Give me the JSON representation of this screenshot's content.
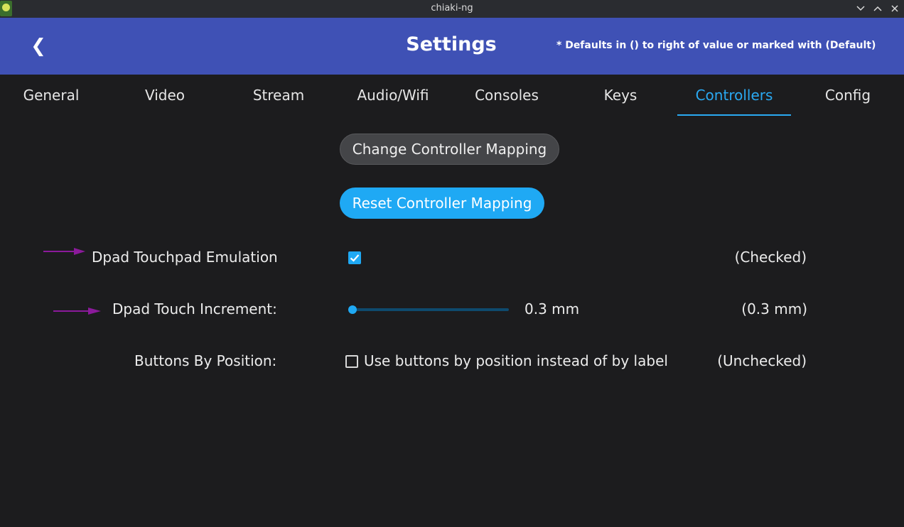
{
  "window": {
    "title": "chiaki-ng",
    "icons": [
      "app-icon",
      "minimize-icon",
      "maximize-icon",
      "close-icon"
    ]
  },
  "header": {
    "back_glyph": "❮",
    "title": "Settings",
    "note": "* Defaults in () to right of value or marked with (Default)",
    "color": "#3f51b5"
  },
  "tabs": [
    {
      "label": "General"
    },
    {
      "label": "Video"
    },
    {
      "label": "Stream"
    },
    {
      "label": "Audio/Wifi"
    },
    {
      "label": "Consoles"
    },
    {
      "label": "Keys"
    },
    {
      "label": "Controllers",
      "active": true
    },
    {
      "label": "Config"
    }
  ],
  "buttons": {
    "change_mapping": "Change Controller Mapping",
    "reset_mapping": "Reset Controller Mapping"
  },
  "settings": {
    "dpad_touchpad": {
      "label": "Dpad Touchpad Emulation",
      "checked": true,
      "default": "(Checked)"
    },
    "dpad_increment": {
      "label": "Dpad Touch Increment:",
      "value": "0.3 mm",
      "level": 0.0,
      "default": "(0.3 mm)"
    },
    "buttons_position": {
      "label": "Buttons By Position:",
      "checkbox_label": "Use buttons by position instead of by label",
      "checked": false,
      "default": "(Unchecked)"
    }
  },
  "colors": {
    "accent": "#1fa9f4",
    "background": "#1c1c1e",
    "annotation_arrow": "#8b1a9b"
  }
}
